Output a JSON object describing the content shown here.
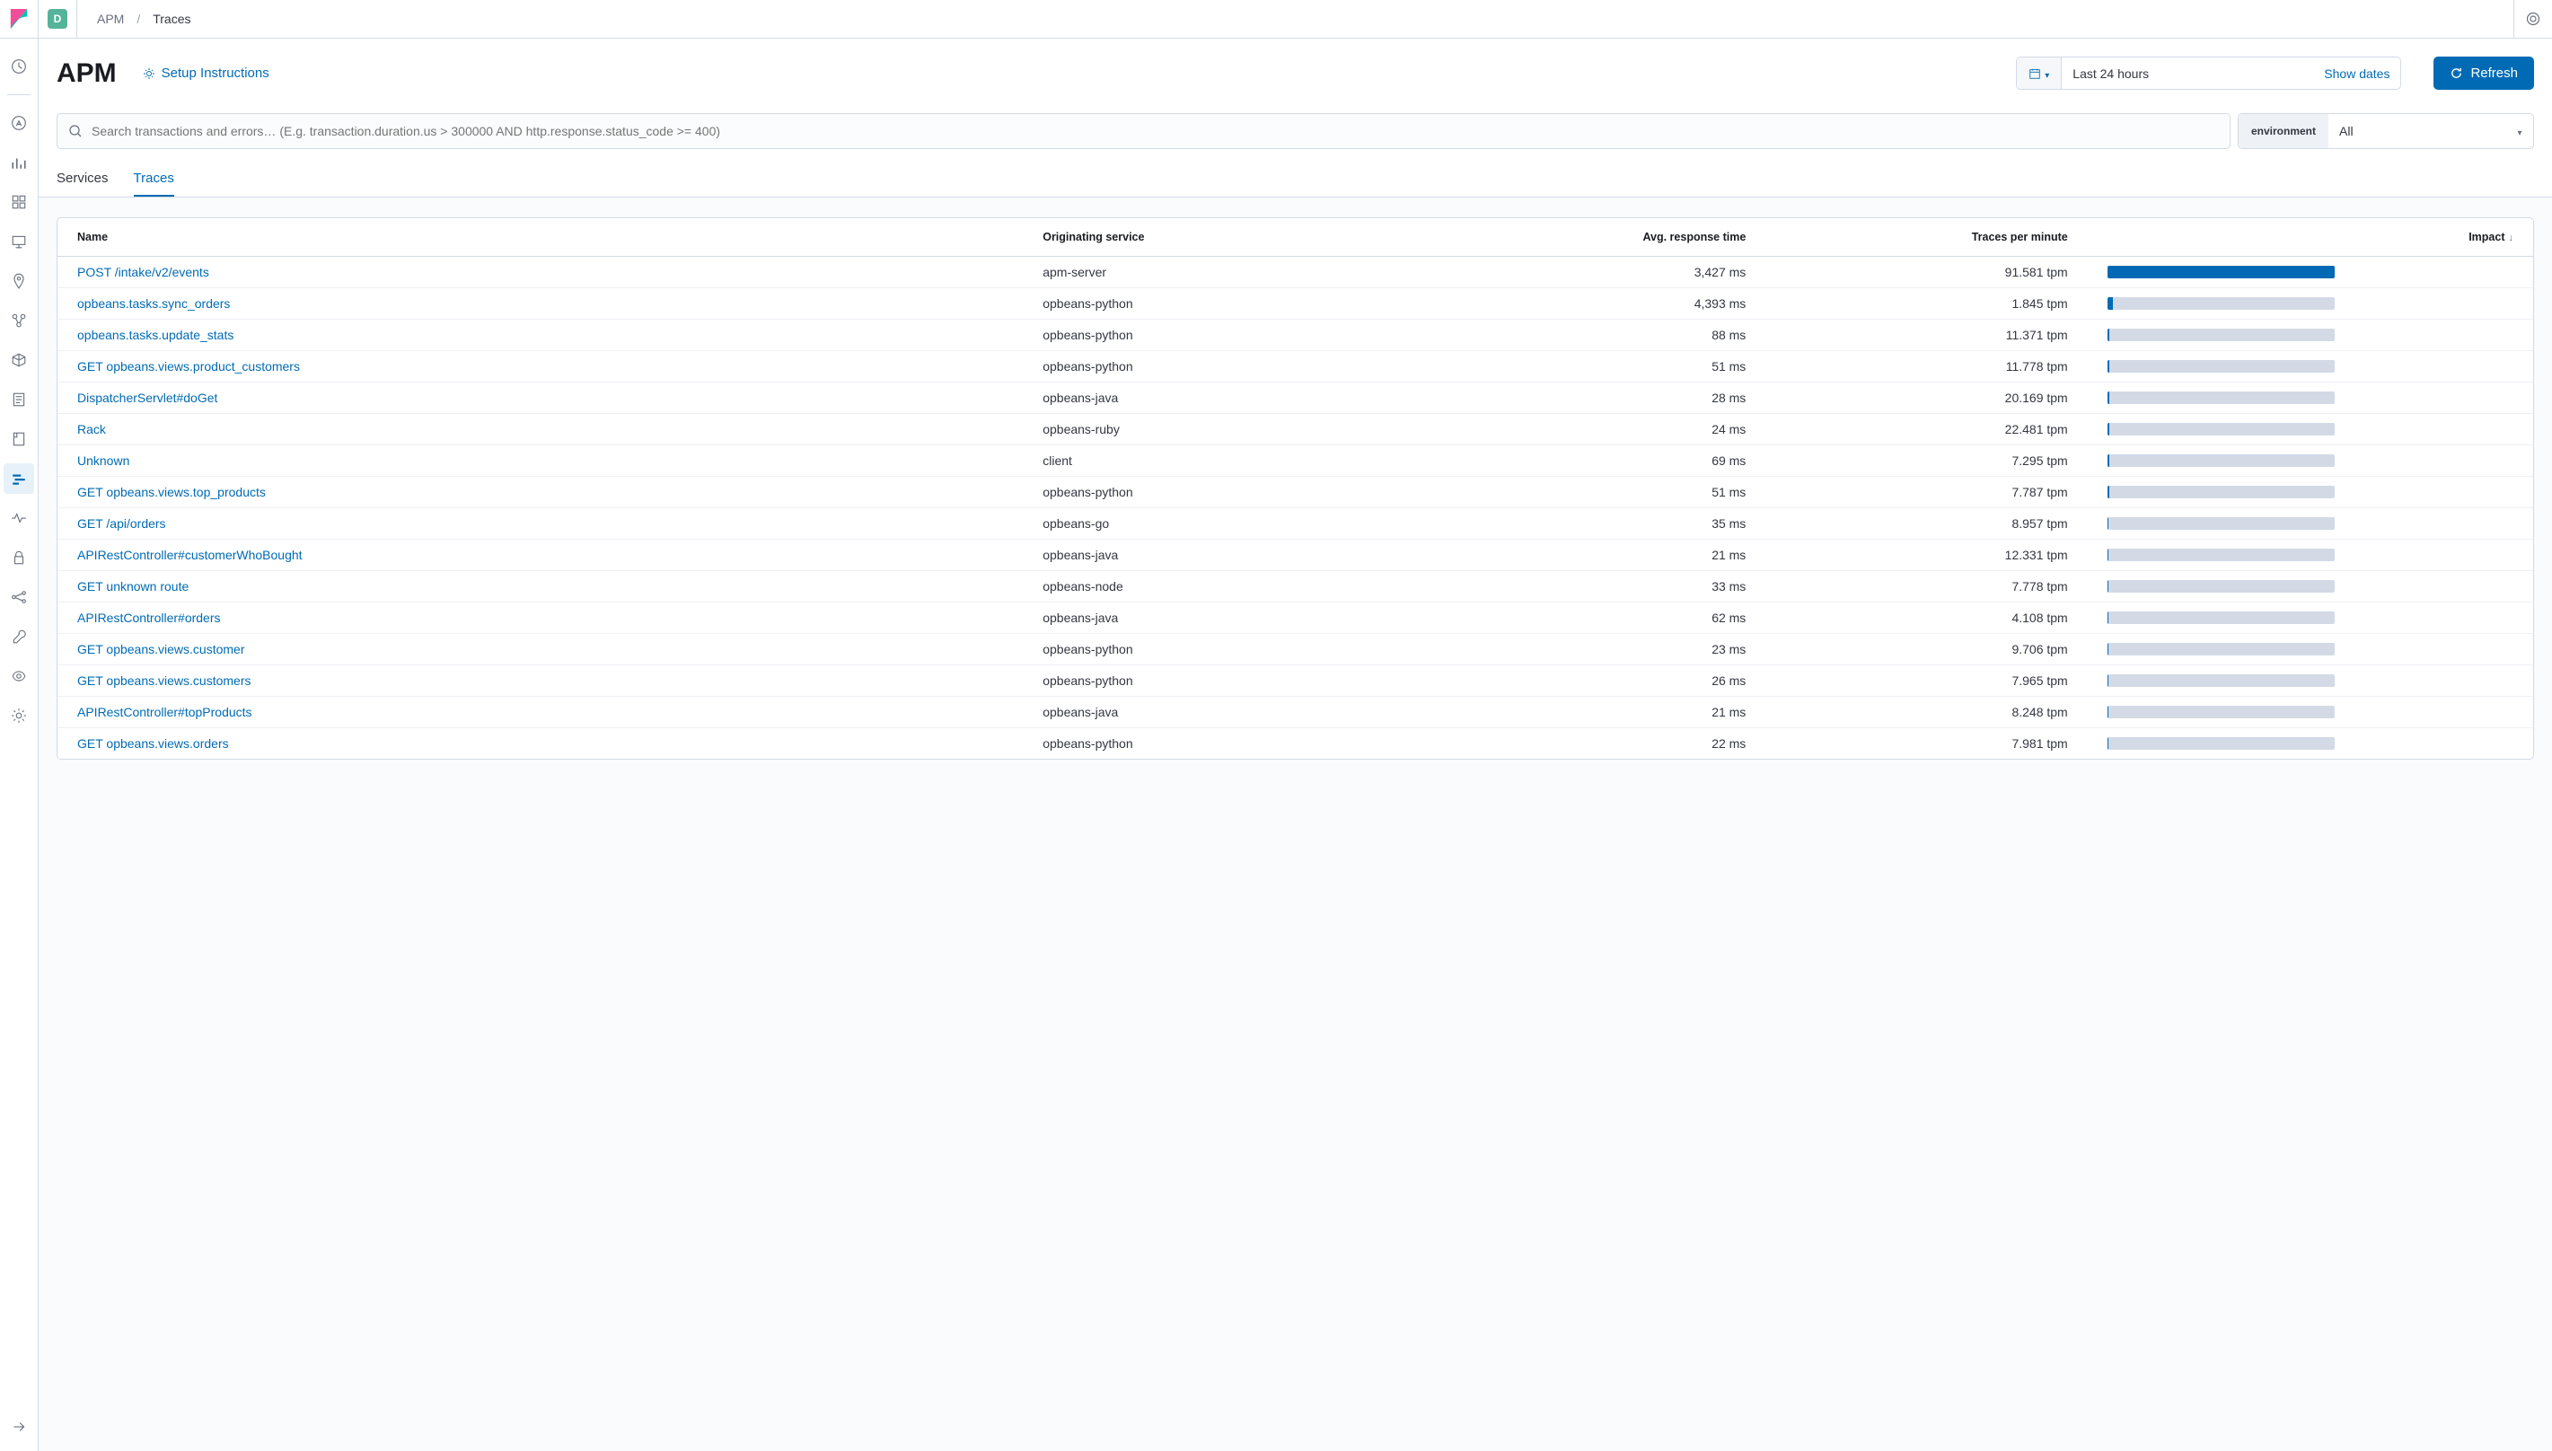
{
  "header": {
    "space_letter": "D",
    "breadcrumbs": {
      "parent": "APM",
      "current": "Traces"
    }
  },
  "page": {
    "title": "APM",
    "setup_label": "Setup Instructions",
    "date_range": "Last 24 hours",
    "show_dates_label": "Show dates",
    "refresh_label": "Refresh",
    "search_placeholder": "Search transactions and errors… (E.g. transaction.duration.us > 300000 AND http.response.status_code >= 400)",
    "env_label": "environment",
    "env_value": "All",
    "tabs": {
      "services": "Services",
      "traces": "Traces"
    }
  },
  "table": {
    "headers": {
      "name": "Name",
      "service": "Originating service",
      "avg": "Avg. response time",
      "tpm": "Traces per minute",
      "impact": "Impact"
    },
    "rows": [
      {
        "name": "POST /intake/v2/events",
        "service": "apm-server",
        "avg": "3,427 ms",
        "tpm": "91.581 tpm",
        "impact": 100
      },
      {
        "name": "opbeans.tasks.sync_orders",
        "service": "opbeans-python",
        "avg": "4,393 ms",
        "tpm": "1.845 tpm",
        "impact": 2.5
      },
      {
        "name": "opbeans.tasks.update_stats",
        "service": "opbeans-python",
        "avg": "88 ms",
        "tpm": "11.371 tpm",
        "impact": 0.8
      },
      {
        "name": "GET opbeans.views.product_customers",
        "service": "opbeans-python",
        "avg": "51 ms",
        "tpm": "11.778 tpm",
        "impact": 0.8
      },
      {
        "name": "DispatcherServlet#doGet",
        "service": "opbeans-java",
        "avg": "28 ms",
        "tpm": "20.169 tpm",
        "impact": 0.8
      },
      {
        "name": "Rack",
        "service": "opbeans-ruby",
        "avg": "24 ms",
        "tpm": "22.481 tpm",
        "impact": 0.8
      },
      {
        "name": "Unknown",
        "service": "client",
        "avg": "69 ms",
        "tpm": "7.295 tpm",
        "impact": 0.8
      },
      {
        "name": "GET opbeans.views.top_products",
        "service": "opbeans-python",
        "avg": "51 ms",
        "tpm": "7.787 tpm",
        "impact": 0.8
      },
      {
        "name": "GET /api/orders",
        "service": "opbeans-go",
        "avg": "35 ms",
        "tpm": "8.957 tpm",
        "impact": 0.6
      },
      {
        "name": "APIRestController#customerWhoBought",
        "service": "opbeans-java",
        "avg": "21 ms",
        "tpm": "12.331 tpm",
        "impact": 0.6
      },
      {
        "name": "GET unknown route",
        "service": "opbeans-node",
        "avg": "33 ms",
        "tpm": "7.778 tpm",
        "impact": 0.6
      },
      {
        "name": "APIRestController#orders",
        "service": "opbeans-java",
        "avg": "62 ms",
        "tpm": "4.108 tpm",
        "impact": 0.6
      },
      {
        "name": "GET opbeans.views.customer",
        "service": "opbeans-python",
        "avg": "23 ms",
        "tpm": "9.706 tpm",
        "impact": 0.6
      },
      {
        "name": "GET opbeans.views.customers",
        "service": "opbeans-python",
        "avg": "26 ms",
        "tpm": "7.965 tpm",
        "impact": 0.6
      },
      {
        "name": "APIRestController#topProducts",
        "service": "opbeans-java",
        "avg": "21 ms",
        "tpm": "8.248 tpm",
        "impact": 0.6
      },
      {
        "name": "GET opbeans.views.orders",
        "service": "opbeans-python",
        "avg": "22 ms",
        "tpm": "7.981 tpm",
        "impact": 0.6
      }
    ]
  }
}
